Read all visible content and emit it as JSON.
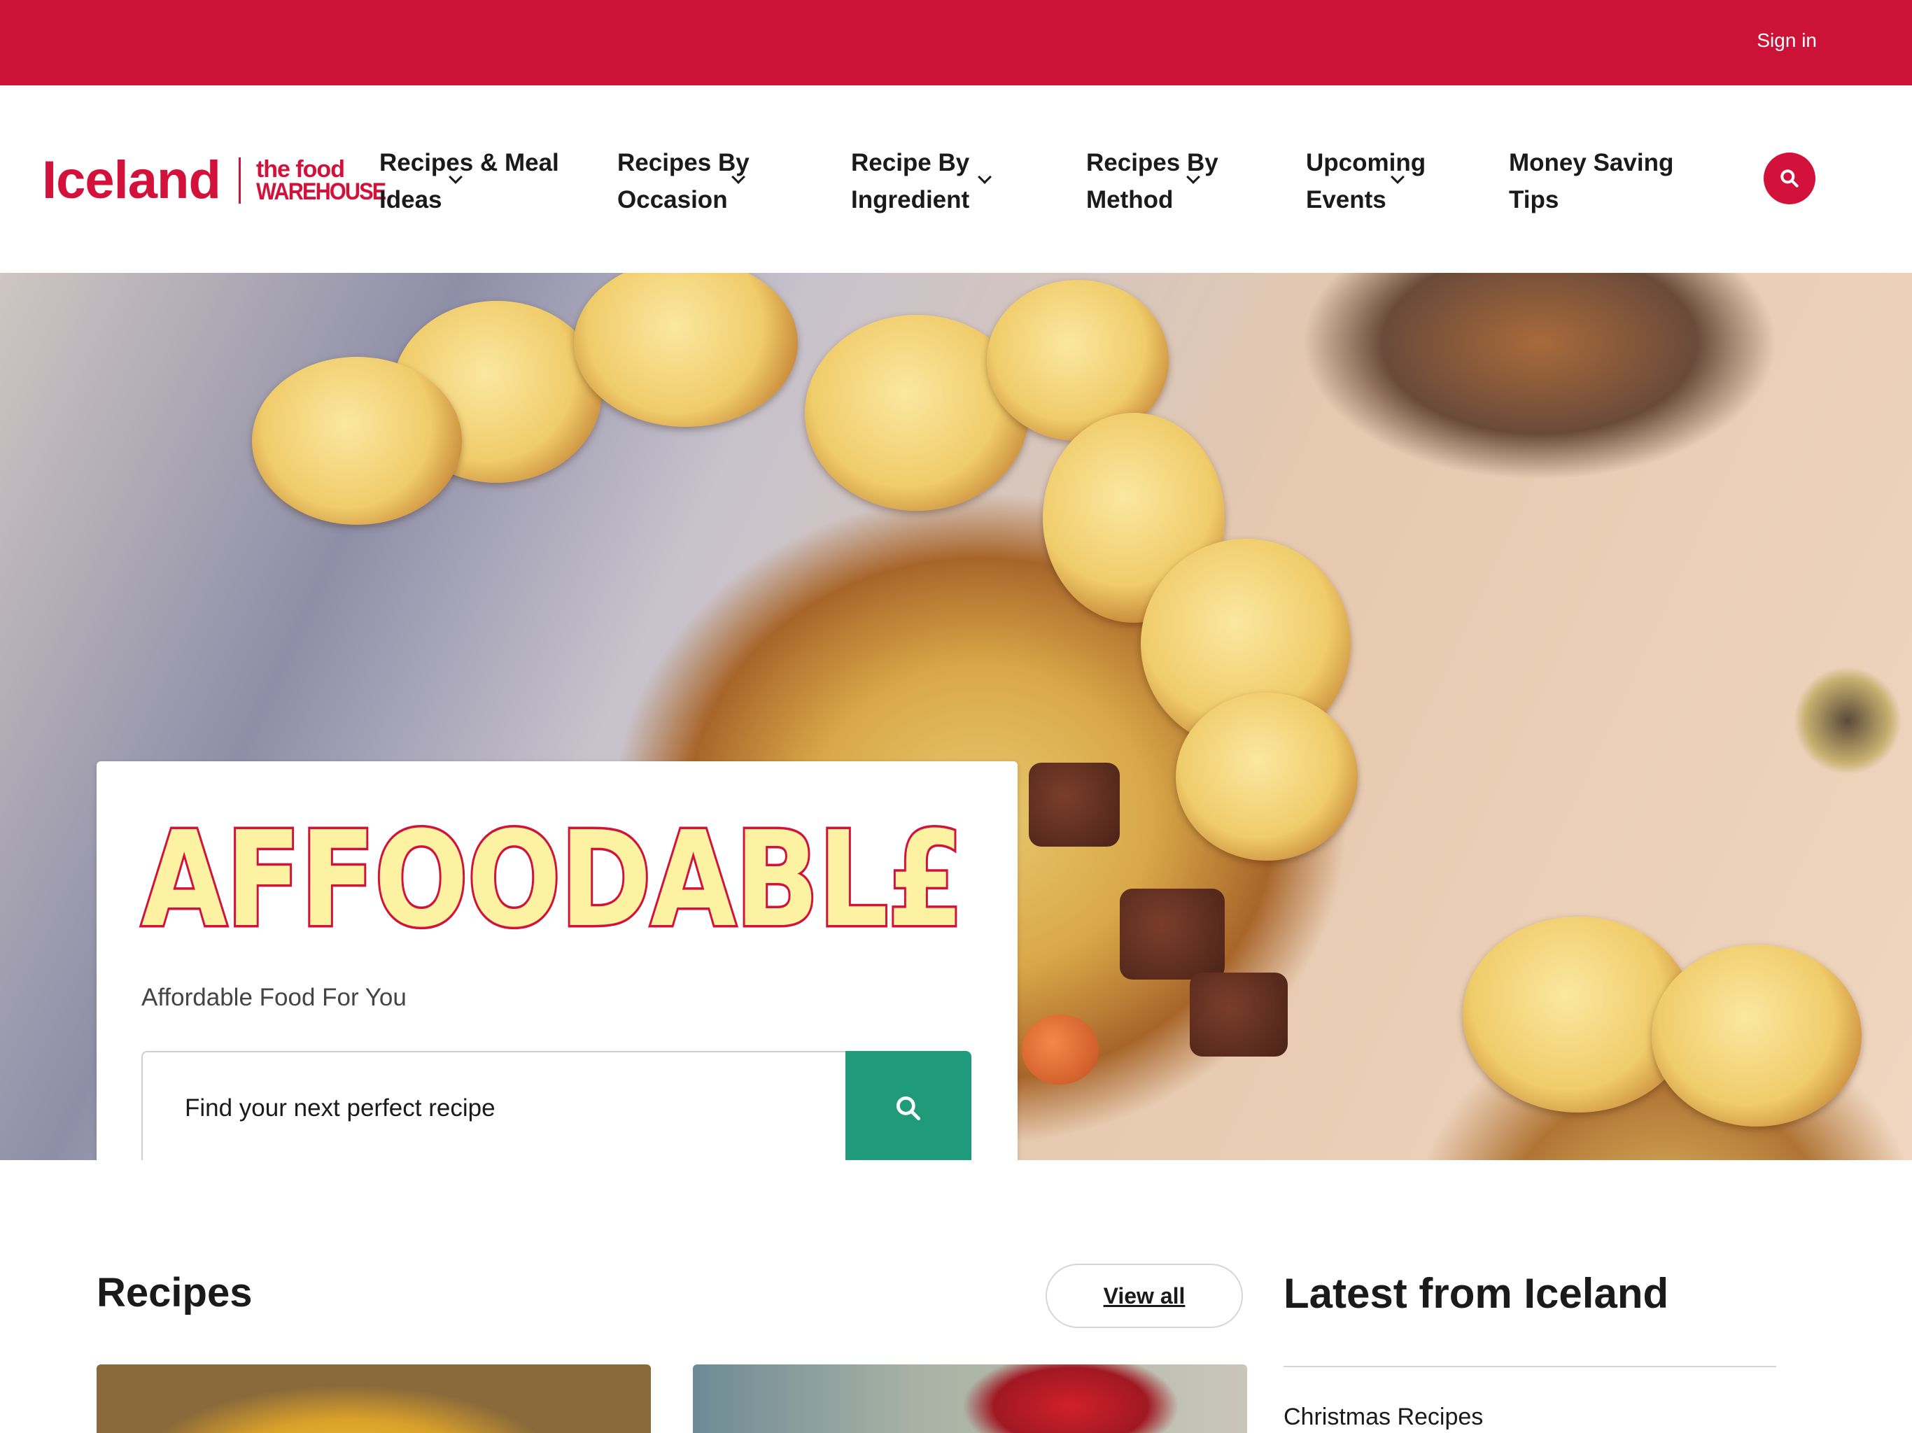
{
  "topbar": {
    "sign_in": "Sign in",
    "color": "#cc1236"
  },
  "logo": {
    "brand": "Iceland",
    "sub_line1": "the food",
    "sub_line2": "WAREHOUSE"
  },
  "nav": {
    "items": [
      {
        "line1": "Recipes & Meal",
        "line2": "Ideas",
        "has_dropdown": true
      },
      {
        "line1": "Recipes By",
        "line2": "Occasion",
        "has_dropdown": true
      },
      {
        "line1": "Recipe By",
        "line2": "Ingredient",
        "has_dropdown": true
      },
      {
        "line1": "Recipes By",
        "line2": "Method",
        "has_dropdown": true
      },
      {
        "line1": "Upcoming",
        "line2": "Events",
        "has_dropdown": true
      },
      {
        "line1": "Money Saving",
        "line2": "Tips",
        "has_dropdown": false
      }
    ],
    "search_icon": "search-icon"
  },
  "hero": {
    "brand_title": "AFFOODABL£",
    "tagline": "Affordable Food For You",
    "search_placeholder": "Find your next perfect recipe",
    "search_button_color": "#1f9a7a"
  },
  "recipes": {
    "title": "Recipes",
    "view_all": "View all"
  },
  "latest": {
    "title": "Latest from Iceland",
    "items": [
      "Christmas Recipes"
    ]
  }
}
